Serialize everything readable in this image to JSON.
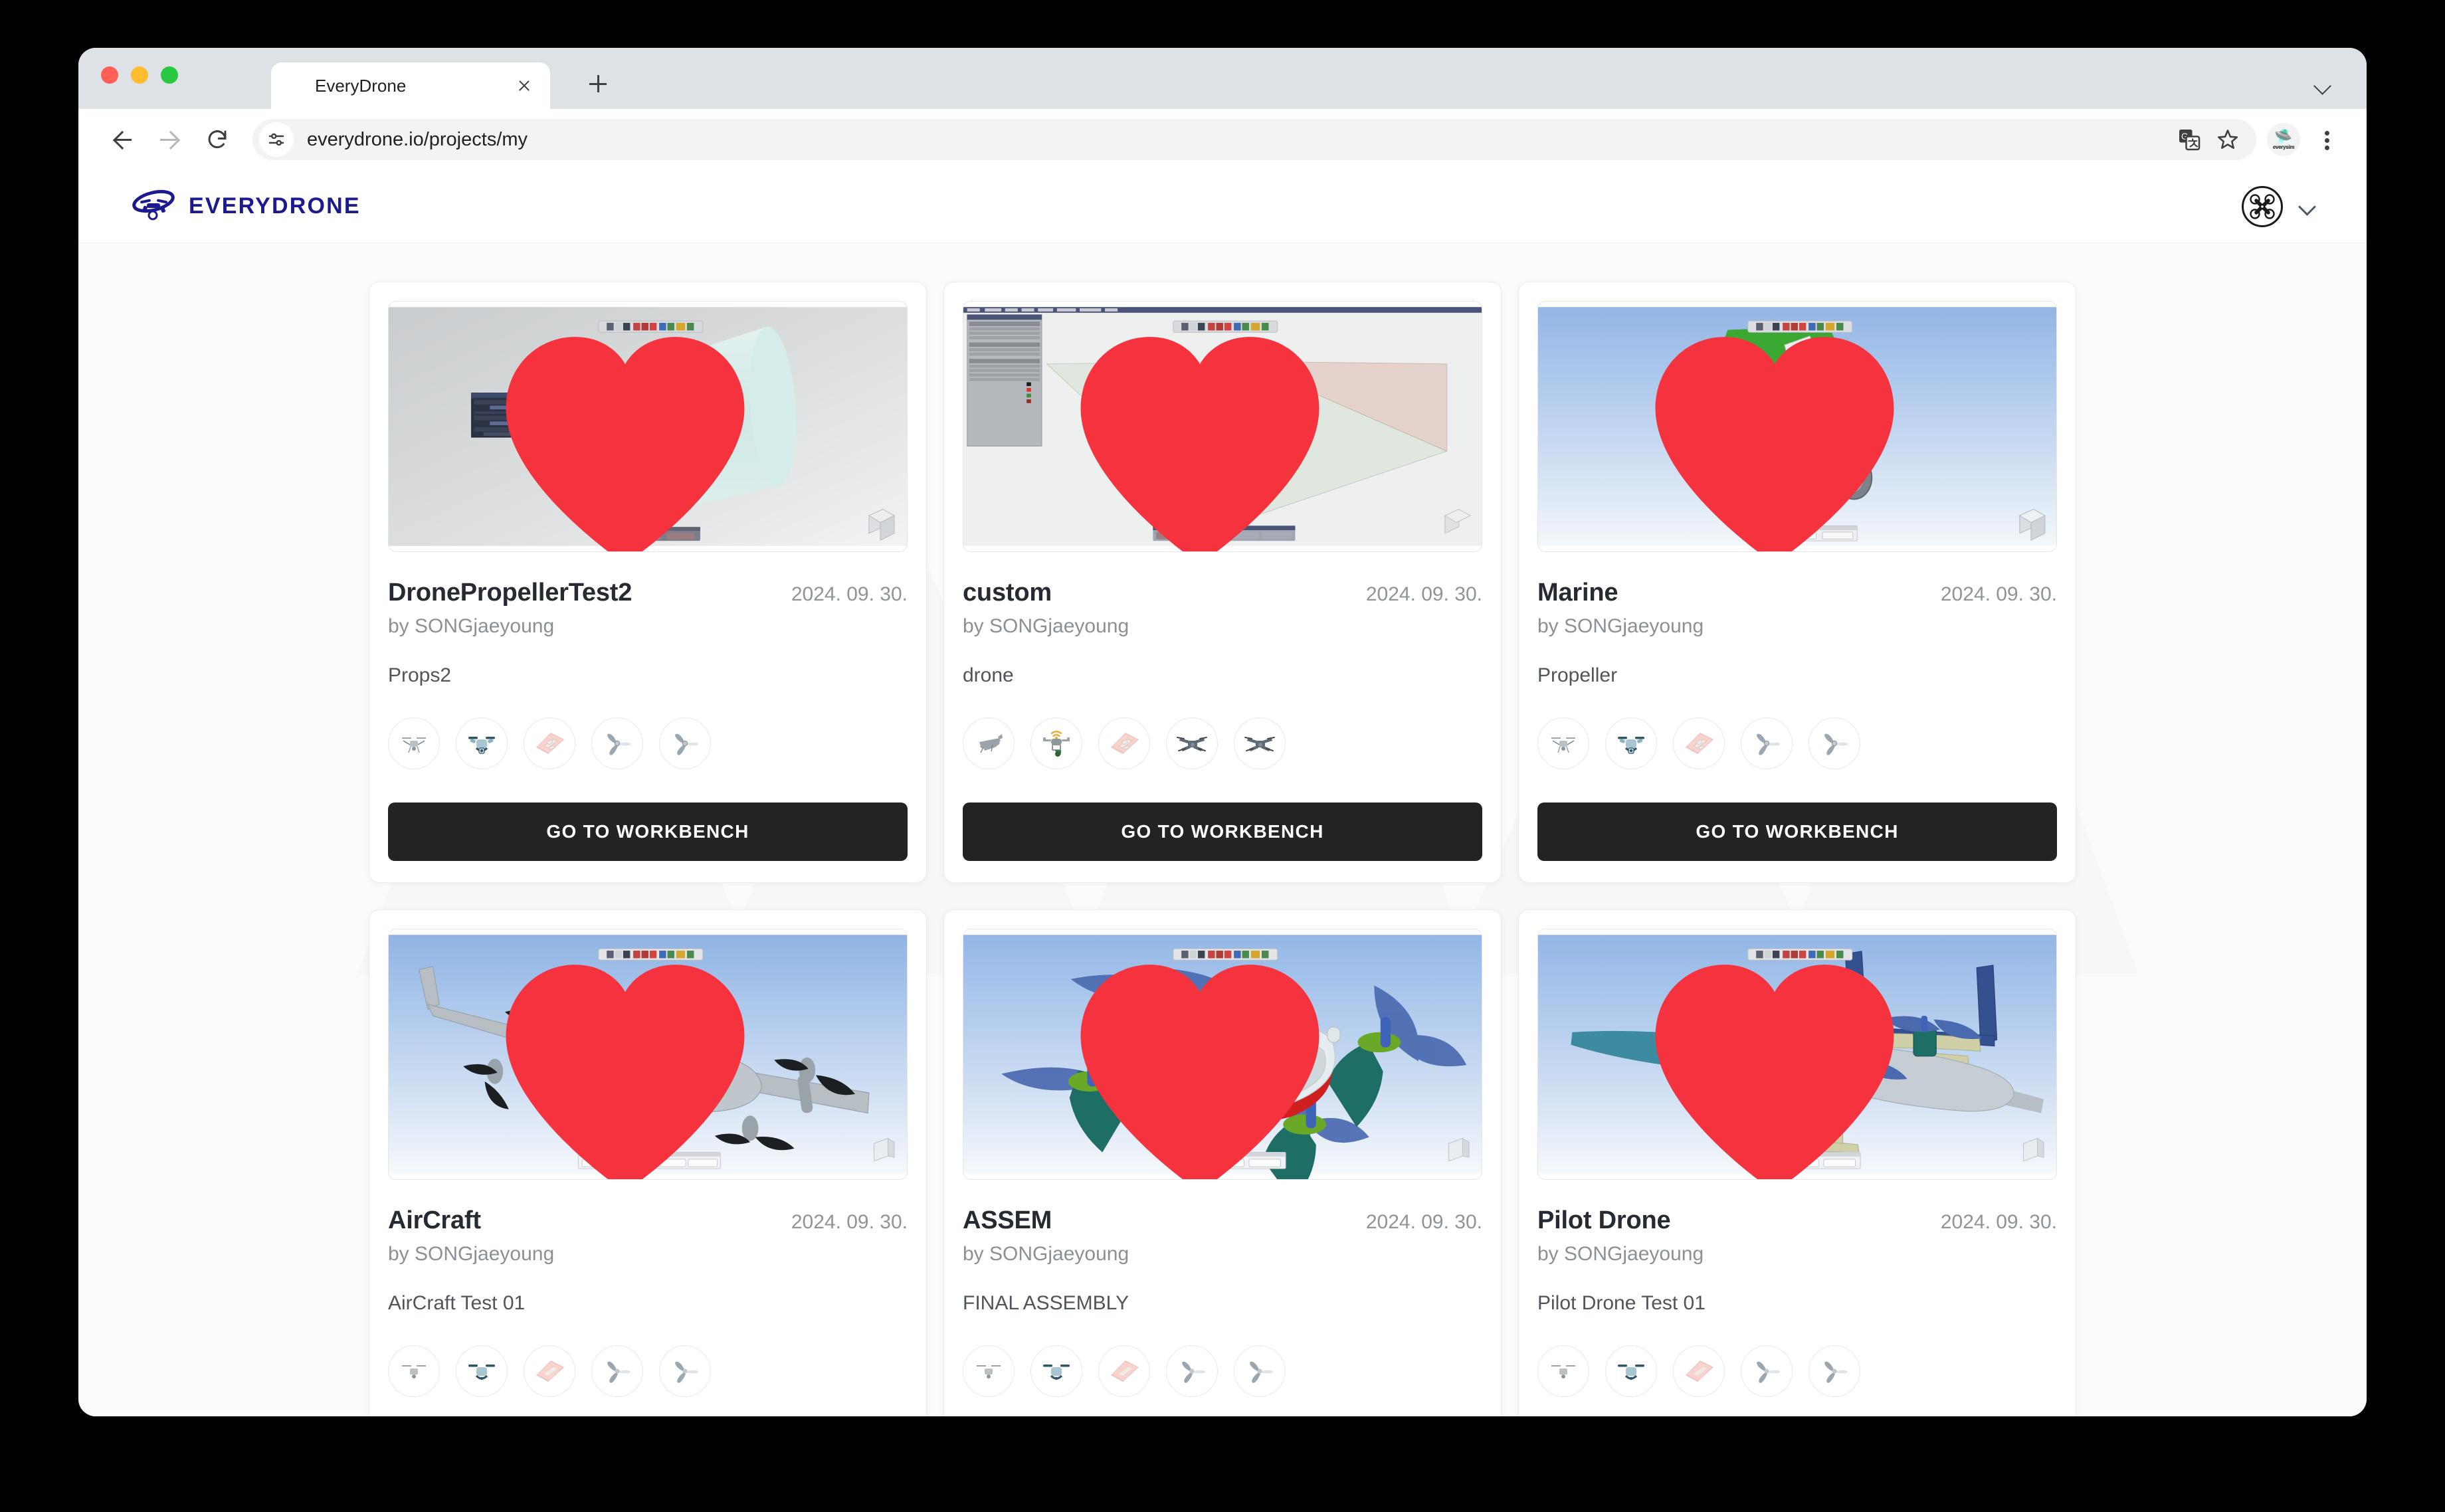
{
  "browser": {
    "tab_title": "EveryDrone",
    "url": "everydrone.io/projects/my",
    "extension_name": "everysim",
    "icons": {
      "back": "back-arrow-icon",
      "forward": "forward-arrow-icon",
      "reload": "reload-icon",
      "site_info": "site-settings-icon",
      "translate": "translate-icon",
      "bookmark": "bookmark-star-icon",
      "menu": "kebab-menu-icon",
      "tab_list": "tab-list-chevron-icon",
      "new_tab": "new-tab-plus-icon",
      "close_tab": "close-tab-icon"
    }
  },
  "site": {
    "brand": "EVERYDRONE",
    "logo_icon": "drone-orbit-logo-icon",
    "avatar_icon": "quadcopter-avatar-icon",
    "avatar_chevron_icon": "chevron-down-icon"
  },
  "labels": {
    "workbench": "GO TO WORKBENCH",
    "by_prefix": "by ",
    "favorite_icon": "heart-filled-icon"
  },
  "projects": [
    {
      "title": "DronePropellerTest2",
      "date": "2024. 09. 30.",
      "author": "by SONGjaeyoung",
      "description": "Props2",
      "favorited": true,
      "thumbnail": "cad-duct-cylinder",
      "tags": [
        "quadcopter-photo-icon",
        "quadcopter-blue-icon",
        "aircraft-plane-pink-icon",
        "propeller-icon",
        "propeller-icon"
      ]
    },
    {
      "title": "custom",
      "date": "2024. 09. 30.",
      "author": "by SONGjaeyoung",
      "description": "drone",
      "favorited": true,
      "thumbnail": "cfd-wind-tunnel-airplane",
      "tags": [
        "fixed-wing-drone-icon",
        "drone-signal-icon",
        "aircraft-plane-pink-icon",
        "quadcopter-dark-icon",
        "quadcopter-dark-icon"
      ]
    },
    {
      "title": "Marine",
      "date": "2024. 09. 30.",
      "author": "by SONGjaeyoung",
      "description": "Propeller",
      "favorited": true,
      "thumbnail": "landing-gear-mechanism",
      "tags": [
        "quadcopter-photo-icon",
        "quadcopter-blue-icon",
        "aircraft-plane-pink-icon",
        "propeller-icon",
        "propeller-icon"
      ]
    },
    {
      "title": "AirCraft",
      "date": "2024. 09. 30.",
      "author": "by SONGjaeyoung",
      "description": "AirCraft Test 01",
      "favorited": true,
      "thumbnail": "vtol-grey-aircraft",
      "tags": [
        "quadcopter-photo-icon",
        "quadcopter-blue-icon",
        "aircraft-plane-pink-icon",
        "propeller-icon",
        "propeller-icon"
      ]
    },
    {
      "title": "ASSEM",
      "date": "2024. 09. 30.",
      "author": "by SONGjaeyoung",
      "description": "FINAL ASSEMBLY",
      "favorited": true,
      "thumbnail": "quadcopter-assembly",
      "tags": [
        "quadcopter-photo-icon",
        "quadcopter-blue-icon",
        "aircraft-plane-pink-icon",
        "propeller-icon",
        "propeller-icon"
      ]
    },
    {
      "title": "Pilot Drone",
      "date": "2024. 09. 30.",
      "author": "by SONGjaeyoung",
      "description": "Pilot Drone Test 01",
      "favorited": true,
      "thumbnail": "pilot-vtol-aircraft",
      "tags": [
        "quadcopter-photo-icon",
        "quadcopter-blue-icon",
        "aircraft-plane-pink-icon",
        "propeller-icon",
        "propeller-icon"
      ]
    }
  ],
  "colors": {
    "brand_navy": "#1b1b8f",
    "button_dark": "#232323",
    "heart_red": "#f5333f",
    "page_bg": "#fbfbfc",
    "card_bg": "#ffffff"
  }
}
